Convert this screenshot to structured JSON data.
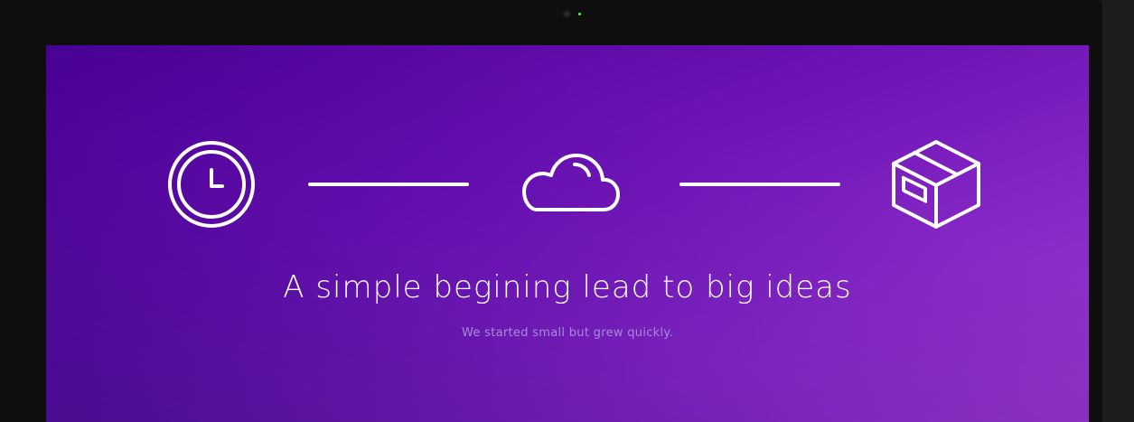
{
  "hero": {
    "headline": "A simple begining lead to big ideas",
    "subheadline": "We started small but grew quickly."
  },
  "icons": [
    "clock-icon",
    "cloud-icon",
    "box-icon"
  ],
  "colors": {
    "gradient_start": "#4a0094",
    "gradient_end": "#9638c8",
    "icon_stroke": "#ffffff",
    "subheadline_text": "#a78bdc",
    "device_frame": "#111111",
    "camera_led": "#4cff4c"
  }
}
